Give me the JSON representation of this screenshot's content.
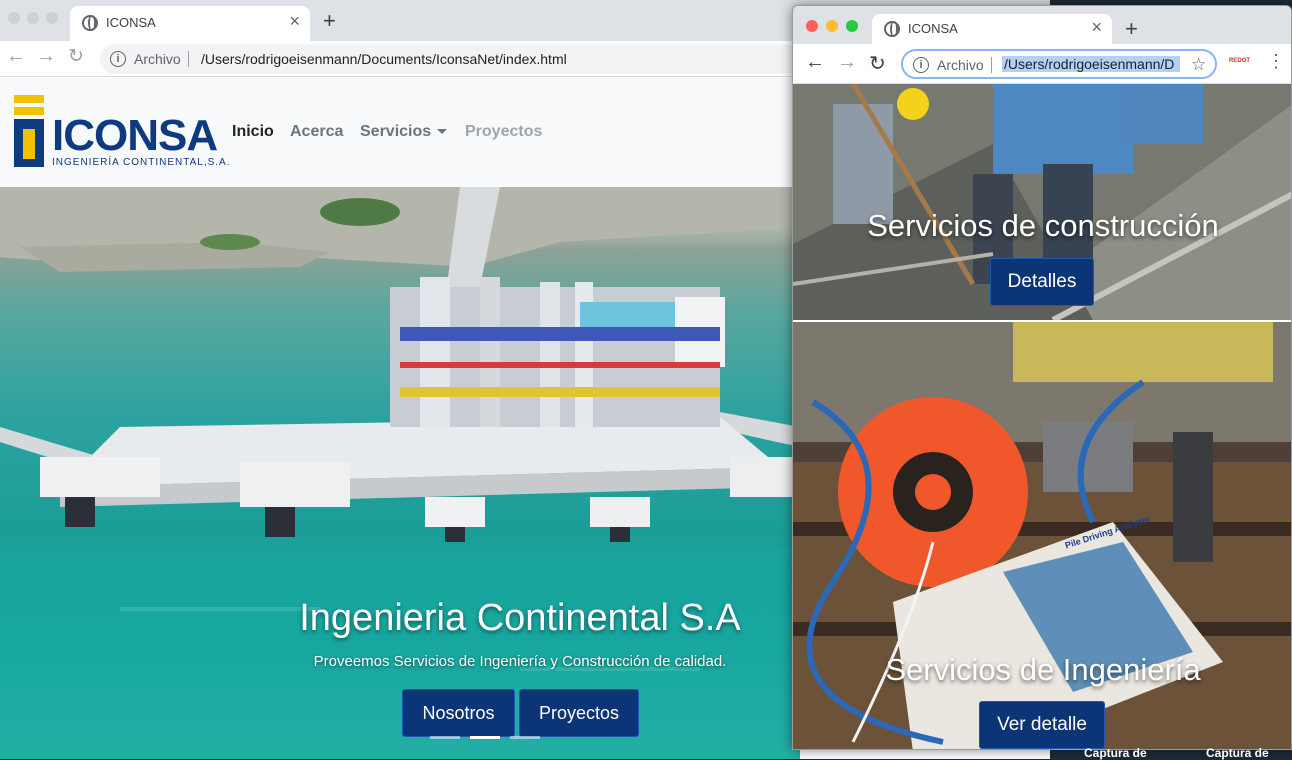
{
  "back_window": {
    "tab_title": "ICONSA",
    "archivo_label": "Archivo",
    "url": "/Users/rodrigoeisenmann/Documents/IconsaNet/index.html"
  },
  "site": {
    "logo_text": "ICONSA",
    "logo_subtitle": "INGENIERÍA CONTINENTAL,S.A.",
    "nav": {
      "inicio": "Inicio",
      "acerca": "Acerca",
      "servicios": "Servicios",
      "proyectos": "Proyectos"
    },
    "hero": {
      "title": "Ingenieria Continental S.A",
      "subtitle": "Proveemos Servicios de Ingeniería y Construcción de calidad.",
      "btn_nosotros": "Nosotros",
      "btn_proyectos": "Proyectos"
    }
  },
  "front_window": {
    "tab_title": "ICONSA",
    "archivo_label": "Archivo",
    "url": "/Users/rodrigoeisenmann/D",
    "card1": {
      "title": "Servicios de construcción",
      "button": "Detalles"
    },
    "card2": {
      "title": "Servicios de Ingeniería",
      "button": "Ver detalle",
      "device_label": "Pile Driving Analyzer"
    }
  },
  "desktop": {
    "captura1": "Captura de",
    "captura2": "Captura de"
  },
  "colors": {
    "brand_blue": "#0b3576",
    "logo_yellow": "#f2c200"
  }
}
